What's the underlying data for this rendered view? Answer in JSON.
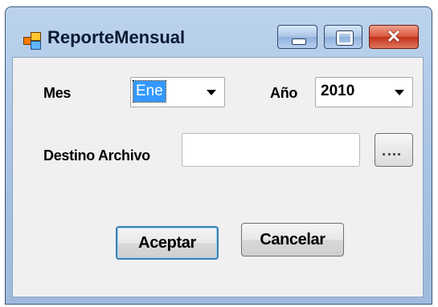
{
  "window": {
    "title": "ReporteMensual",
    "controls": {
      "minimize": "minimize-icon",
      "maximize": "maximize-icon",
      "close": "close-icon"
    }
  },
  "form": {
    "mes_label": "Mes",
    "mes_value": "Ene",
    "anio_label": "Año",
    "anio_value": "2010",
    "destino_label": "Destino Archivo",
    "destino_value": "",
    "browse_icon": "ellipsis-icon"
  },
  "buttons": {
    "accept": "Aceptar",
    "cancel": "Cancelar"
  },
  "colors": {
    "selection": "#3399ff",
    "close_button": "#c1301a"
  }
}
